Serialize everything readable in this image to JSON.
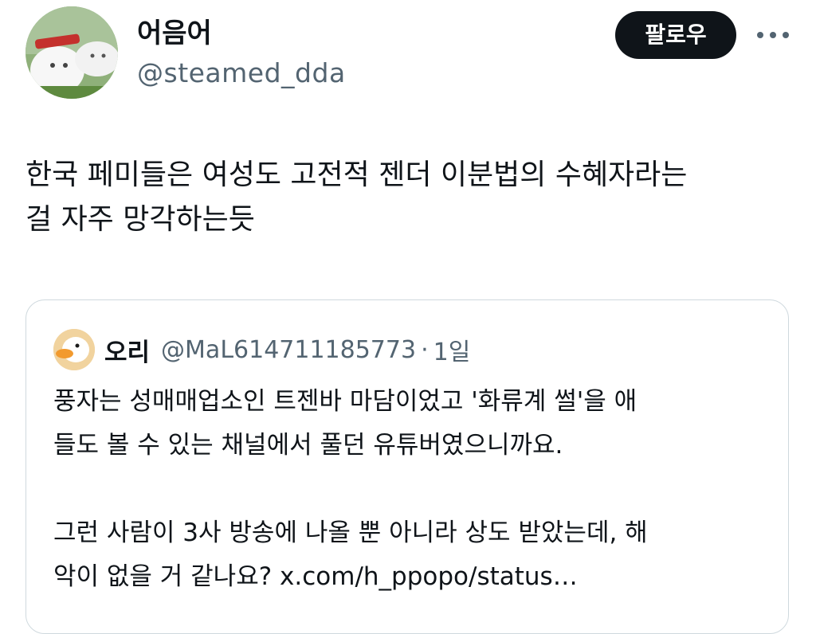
{
  "author": {
    "display_name": "어음어",
    "handle": "@steamed_dda",
    "avatar": "avatar-photo"
  },
  "actions": {
    "follow_label": "팔로우",
    "more_icon": "more-horizontal-icon"
  },
  "tweet": {
    "text_line1": "한국 페미들은 여성도 고전적 젠더 이분법의 수혜자라는",
    "text_line2": "걸 자주 망각하는듯"
  },
  "quote": {
    "display_name": "오리",
    "handle": "@MaL614711185773",
    "separator": "·",
    "time": "1일",
    "avatar": "duck-avatar",
    "para1_line1": "풍자는 성매매업소인 트젠바 마담이었고 '화류계 썰'을 애",
    "para1_line2": "들도 볼 수 있는 채널에서 풀던 유튜버였으니까요.",
    "para2_line1": "그런 사람이 3사 방송에 나올 뿐 아니라 상도 받았는데, 해",
    "para2_line2_text": "악이 없을 거 같나요? ",
    "link_text": "x.com/h_ppopo/status…"
  },
  "colors": {
    "text_primary": "#0f1419",
    "text_secondary": "#536471",
    "button_bg": "#0f1419",
    "button_text": "#ffffff",
    "border": "#cfd9de"
  }
}
